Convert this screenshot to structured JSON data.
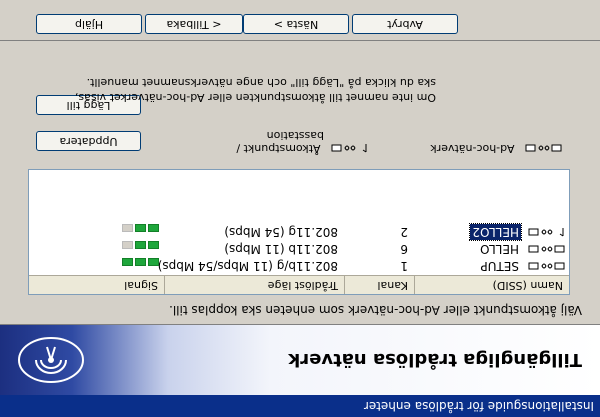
{
  "window": {
    "title": "Installationsguide för trådlösa enheter"
  },
  "banner": {
    "title": "Tillgängliga trådlösa nätverk"
  },
  "instruction": "Välj åtkomstpunkt eller Ad-hoc-nätverk som enheten ska kopplas till.",
  "table": {
    "headers": {
      "ssid": "Namn (SSID)",
      "channel": "Kanal",
      "mode": "Trådlöst läge",
      "signal": "Signal"
    },
    "rows": [
      {
        "ssid": "SETUP",
        "channel": "1",
        "mode": "802.11b/g (11 Mbps/54 Mbps)",
        "signal": 3,
        "icon": "adhoc-network-icon",
        "selected": false
      },
      {
        "ssid": "HELLO",
        "channel": "6",
        "mode": "802.11b (11 Mbps)",
        "signal": 2,
        "icon": "adhoc-network-icon",
        "selected": false
      },
      {
        "ssid": "HELLO2",
        "channel": "2",
        "mode": "802.11g (54 Mbps)",
        "signal": 2,
        "icon": "access-point-icon",
        "selected": true
      }
    ],
    "signal_max": 3
  },
  "legend": {
    "adhoc": "Ad-hoc-nätverk",
    "access_point_line1": "Åtkomstpunkt /",
    "access_point_line2": "basstation"
  },
  "buttons": {
    "refresh": "Uppdatera",
    "add": "Lägg till",
    "help": "Hjälp",
    "back": "< Tillbaka",
    "next": "Nästa >",
    "cancel": "Avbryt"
  },
  "add_text": {
    "line1": "Om inte namnet till åtkomstpunkten eller Ad-hoc-nätverket visas,",
    "line2": "ska du klicka på \"Lägg till\" och ange nätverksnamnet manuellt."
  },
  "colors": {
    "title_bar": "#0a2f8a",
    "selection": "#0a246a",
    "signal_on": "#1ea63b",
    "signal_off": "#d4d0c8"
  }
}
